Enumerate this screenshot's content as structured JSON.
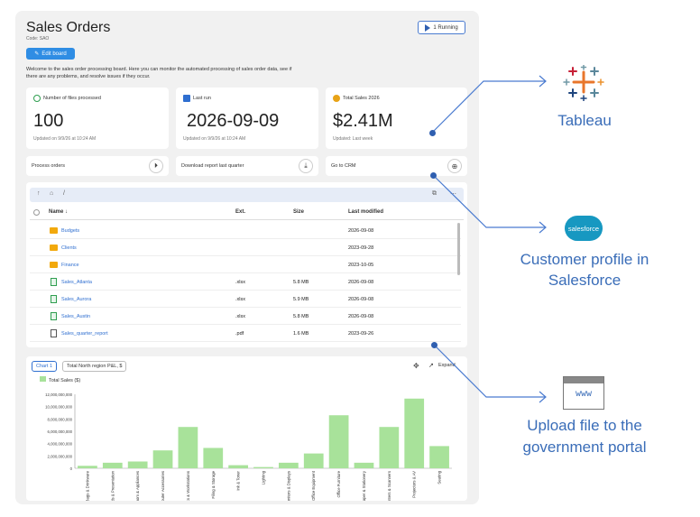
{
  "header": {
    "title": "Sales Orders",
    "code": "Code: SAO",
    "running_label": "1 Running",
    "edit_label": "Edit board"
  },
  "welcome": "Welcome to the sales order processing board. Here you can monitor the automated processing of sales order data, see if there are any problems, and resolve issues if they occur.",
  "cards": [
    {
      "title": "Number of files processed",
      "value": "100",
      "updated": "Updated on 9/9/26 at 10:24 AM",
      "color": "#2e9e4f"
    },
    {
      "title": "Last run",
      "value": "2026-09-09",
      "updated": "Updated on 9/9/26 at 10:24 AM",
      "color": "#2f6fd0"
    },
    {
      "title": "Total Sales 2026",
      "value": "$2.41M",
      "updated": "Updated: Last week",
      "color": "#e8a317"
    }
  ],
  "actions": [
    {
      "label": "Process orders",
      "icon": "play-circle-icon",
      "glyph": "⏵"
    },
    {
      "label": "Download report last quarter",
      "icon": "download-icon",
      "glyph": "⤓"
    },
    {
      "label": "Go to CRM",
      "icon": "globe-icon",
      "glyph": "⊕"
    }
  ],
  "files": {
    "path": "/",
    "columns": {
      "name": "Name ↓",
      "ext": "Ext.",
      "size": "Size",
      "modified": "Last modified"
    },
    "rows": [
      {
        "name": "Budgets",
        "ext": "",
        "size": "",
        "modified": "2026-09-08",
        "type": "folder"
      },
      {
        "name": "Clients",
        "ext": "",
        "size": "",
        "modified": "2023-09-28",
        "type": "folder"
      },
      {
        "name": "Finance",
        "ext": "",
        "size": "",
        "modified": "2023-10-05",
        "type": "folder"
      },
      {
        "name": "Sales_Atlanta",
        "ext": ".xlsx",
        "size": "5.8 MB",
        "modified": "2026-09-08",
        "type": "xlsx"
      },
      {
        "name": "Sales_Aurora",
        "ext": ".xlsx",
        "size": "5.9 MB",
        "modified": "2026-09-08",
        "type": "xlsx"
      },
      {
        "name": "Sales_Austin",
        "ext": ".xlsx",
        "size": "5.8 MB",
        "modified": "2026-09-08",
        "type": "xlsx"
      },
      {
        "name": "Sales_quarter_report",
        "ext": ".pdf",
        "size": "1.6 MB",
        "modified": "2023-09-26",
        "type": "pdf"
      }
    ]
  },
  "chart_tabs": {
    "tab1": "Chart 1",
    "tab2": "Total North region P&L, $",
    "expand": "Expand"
  },
  "chart_data": {
    "type": "bar",
    "legend": "Total Sales ($)",
    "ylim": [
      0,
      12000000000
    ],
    "yticks": [
      "12,000,000,000",
      "10,000,000,000",
      "8,000,000,000",
      "6,000,000,000",
      "4,000,000,000",
      "2,000,000,000",
      "0"
    ],
    "categories": [
      "Bags & Drinkware",
      "Boards & Presentation",
      "Breakroom & Appliances",
      "Computer Accessories",
      "Desks & Workstations",
      "Filing & Storage",
      "Ink & Toner",
      "Lighting",
      "Monitors & Displays",
      "Office Equipment",
      "Office Furniture",
      "Paper & Stationery",
      "Printers & Scanners",
      "Projectors & AV",
      "Seating"
    ],
    "values": [
      400000000,
      900000000,
      1100000000,
      2900000000,
      6700000000,
      3300000000,
      500000000,
      200000000,
      900000000,
      2400000000,
      8600000000,
      900000000,
      6700000000,
      11300000000,
      3600000000
    ],
    "color": "#a8e29a"
  },
  "right": {
    "tableau": "Tableau",
    "salesforce": "Customer profile in Salesforce",
    "salesforce_logo": "salesforce",
    "gov": "Upload file to the government portal",
    "www": "www"
  },
  "colors": {
    "accent": "#2f8de4",
    "link": "#2f6fd0",
    "connector": "#4a7bd0"
  }
}
